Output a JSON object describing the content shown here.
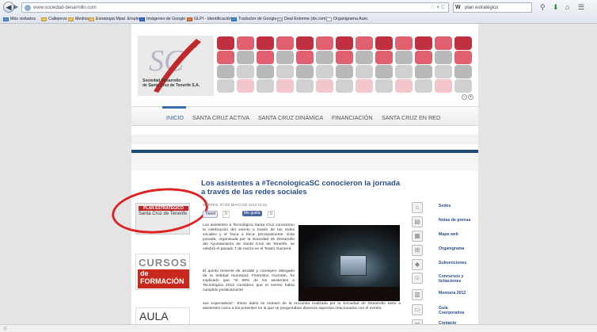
{
  "browser": {
    "url": "www.sociedad-desarrollo.com",
    "search_value": "plan estratégico",
    "search_engine": "W",
    "bookmarks": [
      {
        "label": "Más visitados"
      },
      {
        "label": "Callejeros"
      },
      {
        "label": "Medios"
      },
      {
        "label": "Estrategia Mpal. Empleo"
      },
      {
        "label": "Imágenes de Google"
      },
      {
        "label": "GLPI - Identificación"
      },
      {
        "label": "Traductor de Google"
      },
      {
        "label": "Deal Extreme (dx.com)"
      },
      {
        "label": "Organigrama Auto."
      }
    ]
  },
  "site": {
    "logo_line1": "Sociedad  Desarrollo",
    "logo_line2": "de Santa Cruz de Tenerife S.A.",
    "nav": [
      {
        "label": "INICIO"
      },
      {
        "label": "SANTA CRUZ ACTIVA"
      },
      {
        "label": "SANTA CRUZ DINÁMICA"
      },
      {
        "label": "FINANCIACIÓN"
      },
      {
        "label": "SANTA CRUZ EN RED"
      }
    ],
    "left_banners": {
      "plan_title": "PLAN ESTRATÉGICO",
      "plan_sub": "Santa Cruz de Tenerife",
      "cursos_1": "CURSOS",
      "cursos_2": "de FORMACIÓN",
      "aula": "AULA"
    },
    "article": {
      "title": "Los asistentes a #TecnologicaSC conocieron la jornada a través de las redes sociales",
      "date": "MARTES, 07 DE MAYO DE 2013 10:18",
      "tweet_label": "Tweet",
      "tweet_count": "0",
      "fb_label": "Me gusta",
      "fb_count": "0",
      "para1": "Los asistentes a Tecnológica Santa Cruz conocieron la celebración del evento a través de las redes sociales y el 'boca a boca' principalmente. Esta jornada, organizada por la Sociedad de Desarrollo del Ayuntamiento de Santa Cruz de Tenerife, se celebró el pasado 7 de marzo en el Teatro Guimerá.",
      "para2": "El quinto teniente de alcalde y consejero delegado de la entidad municipal, Florentino Guzmán, ha explicado que \"el 69% de los asistentes a Tecnológica 2013 considero que el evento había cumplido positivamente",
      "para3": "sus expectativas\". Estos datos se extraen de la encuesta realizada por la Sociedad de Desarrollo tanto a asistentes como a los ponentes en la que se preguntaban diversos aspectos relacionados con el evento."
    },
    "sidebar_links": [
      {
        "label": "Sedes",
        "icon": "houses-icon"
      },
      {
        "label": "Notas de prensa",
        "icon": "document-icon"
      },
      {
        "label": "Mapa web",
        "icon": "sitemap-icon"
      },
      {
        "label": "Organigrama",
        "icon": "org-chart-icon"
      },
      {
        "label": "Subvenciones",
        "icon": "tag-icon"
      },
      {
        "label": "Concursos y licitaciones",
        "icon": "person-icon"
      },
      {
        "label": "Memoria 2012",
        "icon": "book-icon"
      },
      {
        "label": "Guía Coorporativa",
        "icon": "guide-icon"
      },
      {
        "label": "Contacto",
        "icon": "mail-icon"
      }
    ]
  },
  "colors": {
    "accent": "#3a6cb0",
    "brand_red": "#c0292a",
    "annotation_circle": "#dd2222"
  }
}
